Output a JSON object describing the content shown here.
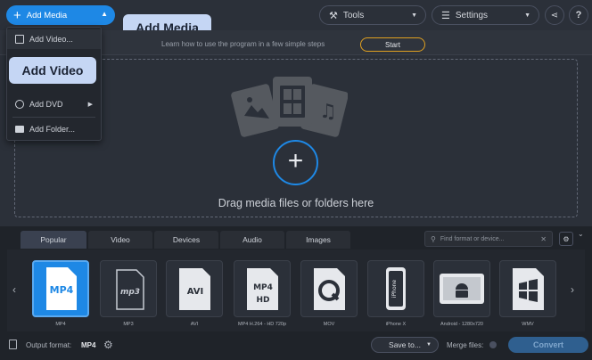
{
  "toolbar": {
    "add_media_label": "Add Media",
    "tools_label": "Tools",
    "settings_label": "Settings"
  },
  "callouts": {
    "add_media": "Add Media",
    "add_video": "Add Video"
  },
  "add_menu": {
    "items": [
      {
        "label": "Add Video...",
        "icon": "film-icon"
      },
      {
        "label": "Add DVD",
        "icon": "disc-icon"
      },
      {
        "label": "Add Folder...",
        "icon": "folder-icon"
      }
    ]
  },
  "learn": {
    "text": "Learn how to use the program in a few simple steps",
    "start_label": "Start"
  },
  "dropzone": {
    "text": "Drag media files or folders here"
  },
  "format_tabs": [
    "Popular",
    "Video",
    "Devices",
    "Audio",
    "Images"
  ],
  "active_tab": "Popular",
  "search": {
    "placeholder": "Find format or device..."
  },
  "formats": [
    {
      "name": "MP4",
      "badge": "MP4",
      "selected": true
    },
    {
      "name": "MP3",
      "badge": "mp3",
      "selected": false
    },
    {
      "name": "AVI",
      "badge": "AVI",
      "selected": false
    },
    {
      "name": "MP4 H.264 - HD 720p",
      "badge": "MP4",
      "selected": false
    },
    {
      "name": "MOV",
      "badge": "",
      "selected": false
    },
    {
      "name": "iPhone X",
      "badge": "iPhone",
      "selected": false
    },
    {
      "name": "Android - 1280x720",
      "badge": "",
      "selected": false
    },
    {
      "name": "WMV",
      "badge": "",
      "selected": false
    }
  ],
  "output": {
    "label": "Output format:",
    "value": "MP4",
    "save_to_label": "Save to...",
    "merge_label": "Merge files:",
    "convert_label": "Convert"
  },
  "colors": {
    "accent": "#1e88e5",
    "start_border": "#e0a020",
    "callout_bg": "#c5d6f4"
  }
}
